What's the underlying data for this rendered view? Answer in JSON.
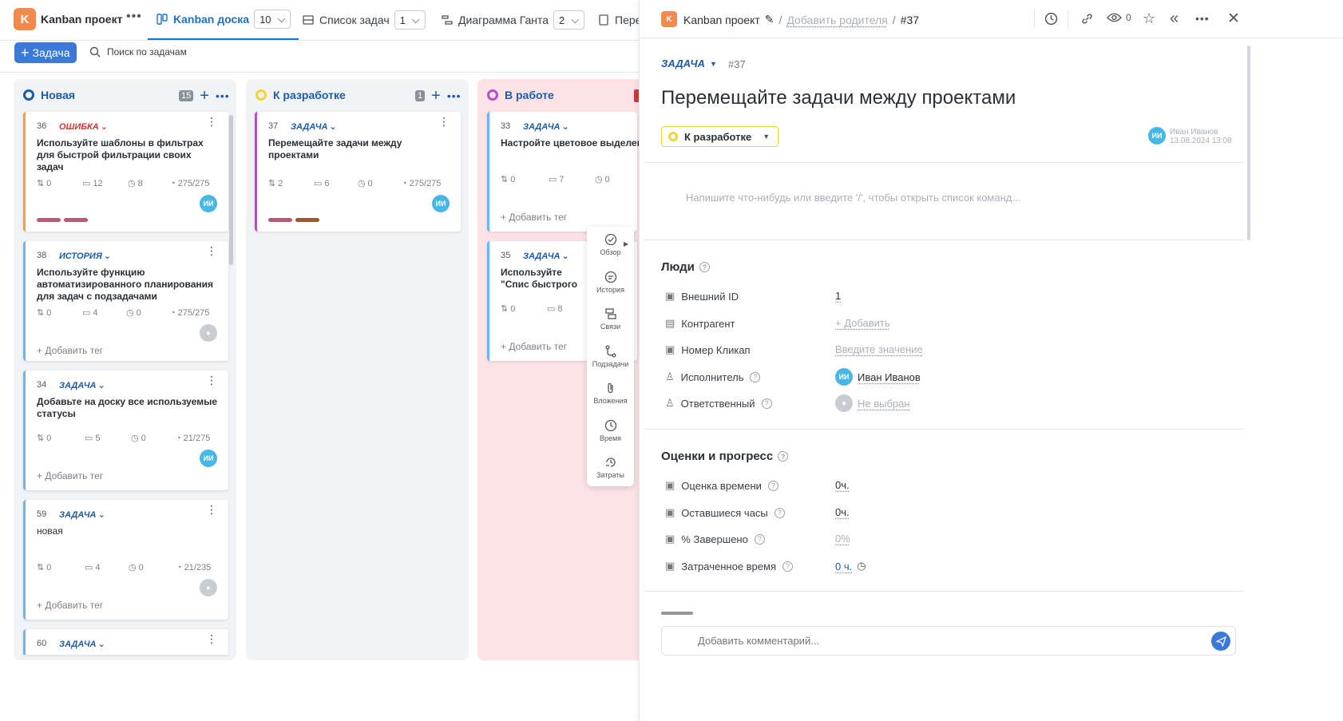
{
  "topbar": {
    "logo_letter": "K",
    "project_name": "Kanban проект",
    "tabs": [
      {
        "label": "Kanban доска",
        "count": "10"
      },
      {
        "label": "Список задач",
        "count": "1"
      },
      {
        "label": "Диаграмма Ганта",
        "count": "2"
      },
      {
        "label": "Пере"
      }
    ]
  },
  "toolbar": {
    "add_label": "Задача",
    "search_placeholder": "Поиск по задачам"
  },
  "board": {
    "add_tag_label": "+ Добавить тег",
    "columns": [
      {
        "name": "Новая",
        "count": "15",
        "color": "#1d5aa8",
        "bg": "#f2f3f5"
      },
      {
        "name": "К разработке",
        "count": "1",
        "color": "#f0d43a",
        "bg": "#f2f3f5"
      },
      {
        "name": "В работе",
        "count": "",
        "color": "#b44fc9",
        "bg": "#fde3e6"
      }
    ],
    "cards": [
      {
        "num": "36",
        "type": "ОШИБКА",
        "title": "Используйте шаблоны в фильтрах для быстрой фильтрации своих задач",
        "subtasks": "0",
        "comments": "12",
        "time": "8",
        "progress": "275/275",
        "avatar": "ИИ"
      },
      {
        "num": "38",
        "type": "ИСТОРИЯ",
        "title": "Используйте функцию автоматизированного планирования для задач с подзадачами",
        "subtasks": "0",
        "comments": "4",
        "time": "0",
        "progress": "275/275"
      },
      {
        "num": "34",
        "type": "ЗАДАЧА",
        "title": "Добавьте на доску все используемые статусы",
        "subtasks": "0",
        "comments": "5",
        "time": "0",
        "progress": "21/275",
        "avatar": "ИИ"
      },
      {
        "num": "59",
        "type": "ЗАДАЧА",
        "title": "новая",
        "subtasks": "0",
        "comments": "4",
        "time": "0",
        "progress": "21/235"
      },
      {
        "num": "60",
        "type": "ЗАДАЧА"
      },
      {
        "num": "37",
        "type": "ЗАДАЧА",
        "title": "Перемещайте задачи между проектами",
        "subtasks": "2",
        "comments": "6",
        "time": "0",
        "progress": "275/275",
        "avatar": "ИИ"
      },
      {
        "num": "33",
        "type": "ЗАДАЧА",
        "title": "Настройте цветовое выделени контекстном меню доски",
        "subtasks": "0",
        "comments": "7",
        "time": "0"
      },
      {
        "num": "35",
        "type": "ЗАДАЧА",
        "title": "Используйте \"Спис быстрого поиска и",
        "subtasks": "0",
        "comments": "8"
      }
    ]
  },
  "mini_menu": [
    "Обзор",
    "История",
    "Связи",
    "Подзадачи",
    "Вложения",
    "Время",
    "Затраты"
  ],
  "panel": {
    "logo_letter": "K",
    "project_name": "Kanban проект",
    "add_parent": "Добавить родителя",
    "task_ref": "#37",
    "watchers": "0",
    "type": "ЗАДАЧА",
    "task_num": "#37",
    "title": "Перемещайте задачи между проектами",
    "status": "К разработке",
    "author_initials": "ИИ",
    "author_name": "Иван Иванов",
    "author_date": "13.08.2024 13:08",
    "editor_placeholder": "Напишите что-нибудь или введите '/', чтобы открыть список команд...",
    "people": {
      "title": "Люди",
      "rows": [
        {
          "label": "Внешний ID",
          "value": "1"
        },
        {
          "label": "Контрагент",
          "value": "+ Добавить"
        },
        {
          "label": "Номер Кликап",
          "value": "Введите значение"
        },
        {
          "label": "Исполнитель",
          "value": "Иван Иванов",
          "initials": "ИИ"
        },
        {
          "label": "Ответственный",
          "value": "Не выбран"
        }
      ]
    },
    "estimates": {
      "title": "Оценки и прогресс",
      "rows": [
        {
          "label": "Оценка времени",
          "value": "0ч."
        },
        {
          "label": "Оставшиеся часы",
          "value": "0ч."
        },
        {
          "label": "% Завершено",
          "value": "0%"
        },
        {
          "label": "Затраченное время",
          "value": "0 ч."
        }
      ]
    },
    "comment_placeholder": "Добавить комментарий..."
  }
}
